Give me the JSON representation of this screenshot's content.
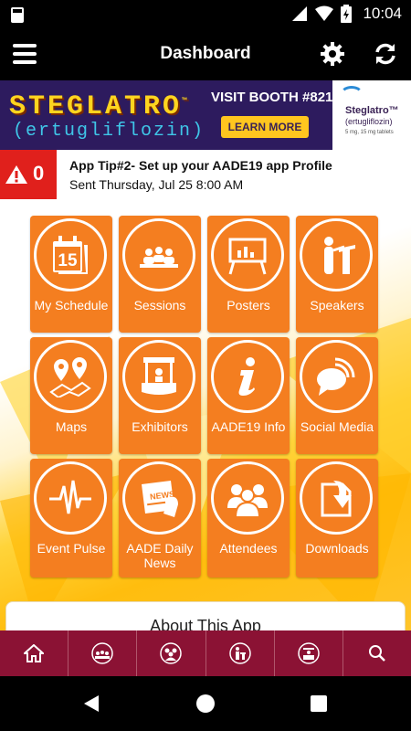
{
  "status_bar": {
    "time": "10:04"
  },
  "app_bar": {
    "title": "Dashboard"
  },
  "banner": {
    "brand": "STEGLATRO",
    "trademark": "™",
    "generic_name": "(ertugliflozin)",
    "booth_text": "VISIT BOOTH #821",
    "button_label": "LEARN MORE",
    "logo_name": "Steglatro™",
    "logo_generic": "(ertugliflozin)",
    "logo_dose": "5 mg, 15 mg tablets"
  },
  "notice": {
    "count": "0",
    "message": "App Tip#2- Set up your AADE19 app Profile",
    "sent": "Sent Thursday, Jul 25 8:00 AM"
  },
  "tiles": [
    {
      "label": "My Schedule",
      "icon": "calendar-icon"
    },
    {
      "label": "Sessions",
      "icon": "audience-icon"
    },
    {
      "label": "Posters",
      "icon": "poster-board-icon"
    },
    {
      "label": "Speakers",
      "icon": "podium-speaker-icon"
    },
    {
      "label": "Maps",
      "icon": "map-pin-icon"
    },
    {
      "label": "Exhibitors",
      "icon": "booth-icon"
    },
    {
      "label": "AADE19 Info",
      "icon": "info-icon"
    },
    {
      "label": "Social Media",
      "icon": "chat-bubbles-icon"
    },
    {
      "label": "Event Pulse",
      "icon": "pulse-icon"
    },
    {
      "label": "AADE Daily News",
      "icon": "newspaper-icon"
    },
    {
      "label": "Attendees",
      "icon": "people-icon"
    },
    {
      "label": "Downloads",
      "icon": "download-icon"
    }
  ],
  "about": {
    "title": "About This App"
  },
  "bottom_nav": [
    {
      "icon": "home-icon"
    },
    {
      "icon": "sessions-icon"
    },
    {
      "icon": "attendees-icon"
    },
    {
      "icon": "speakers-icon"
    },
    {
      "icon": "exhibitors-icon"
    },
    {
      "icon": "search-icon"
    }
  ],
  "colors": {
    "tile": "#f47e20",
    "nav": "#8b1234",
    "alert": "#e0201c",
    "banner": "#2d1b5e"
  }
}
